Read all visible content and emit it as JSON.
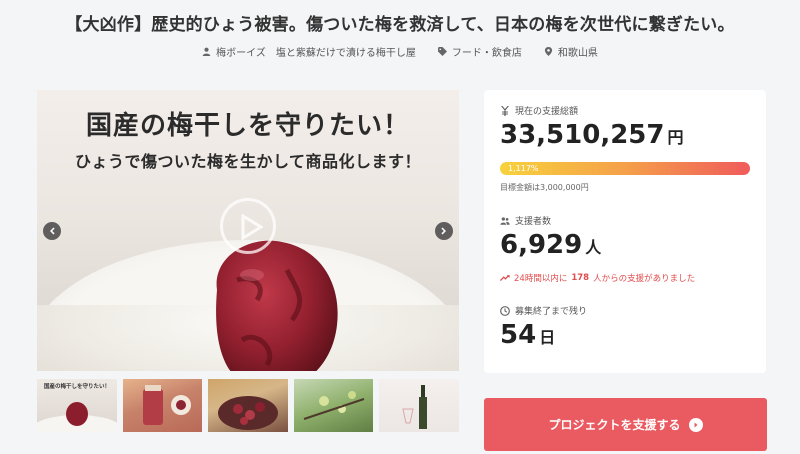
{
  "project": {
    "title": "【大凶作】歴史的ひょう被害。傷ついた梅を救済して、日本の梅を次世代に繋ぎたい。",
    "owner": "梅ボーイズ　塩と紫蘇だけで漬ける梅干し屋",
    "category": "フード・飲食店",
    "location": "和歌山県"
  },
  "hero": {
    "headline": "国産の梅干しを守りたい！",
    "subheadline": "ひょうで傷ついた梅を生かして商品化します！"
  },
  "thumb_overlay": {
    "headline": "国産の梅干しを守りたい！"
  },
  "stats": {
    "total_label": "現在の支援総額",
    "total_amount": "33,510,257",
    "total_unit": "円",
    "progress_percent_text": "1,117%",
    "progress_percent": 1117,
    "goal_text": "目標金額は3,000,000円",
    "supporters_label": "支援者数",
    "supporters": "6,929",
    "supporters_unit": "人",
    "recent_prefix": "24時間以内に",
    "recent_count": "178",
    "recent_suffix": "人からの支援がありました",
    "remaining_label": "募集終了まで残り",
    "remaining_days": "54",
    "remaining_unit": "日"
  },
  "cta": {
    "label": "プロジェクトを支援する"
  },
  "icons": {
    "owner": "user-icon",
    "category": "tag-icon",
    "location": "map-pin-icon",
    "total": "yen-icon",
    "supporters": "users-icon",
    "recent": "trending-up-icon",
    "remaining": "clock-icon"
  },
  "colors": {
    "accent": "#ea5b61",
    "progress_start": "#f7d23c",
    "progress_end": "#ef5b5b",
    "recent": "#e24d4d"
  }
}
